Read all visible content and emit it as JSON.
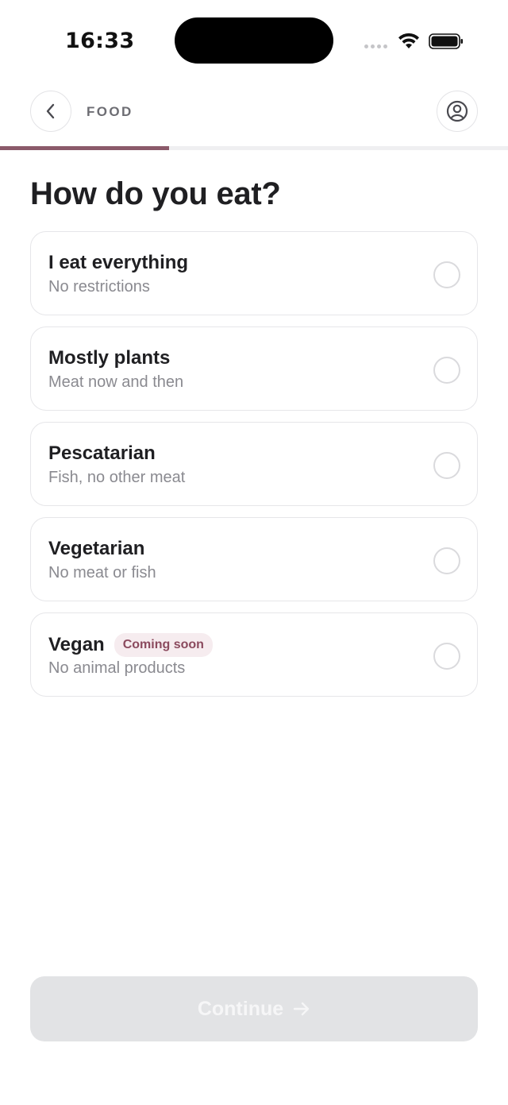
{
  "status_bar": {
    "time": "16:33"
  },
  "header": {
    "section_label": "FOOD"
  },
  "progress": {
    "fraction": 0.333
  },
  "title": "How do you eat?",
  "options": [
    {
      "title": "I eat everything",
      "subtitle": "No restrictions",
      "badge": null,
      "selected": false
    },
    {
      "title": "Mostly plants",
      "subtitle": "Meat now and then",
      "badge": null,
      "selected": false
    },
    {
      "title": "Pescatarian",
      "subtitle": "Fish, no other meat",
      "badge": null,
      "selected": false
    },
    {
      "title": "Vegetarian",
      "subtitle": "No meat or fish",
      "badge": null,
      "selected": false
    },
    {
      "title": "Vegan",
      "subtitle": "No animal products",
      "badge": "Coming soon",
      "selected": false
    }
  ],
  "continue_button": {
    "label": "Continue",
    "enabled": false
  },
  "colors": {
    "accent": "#8b5a6a",
    "badge_bg": "#f6ecef",
    "badge_text": "#8b4a5e",
    "disabled_button": "#e2e3e5"
  },
  "icons": {
    "back": "chevron-left-icon",
    "profile": "user-circle-icon",
    "continue": "arrow-right-icon"
  }
}
